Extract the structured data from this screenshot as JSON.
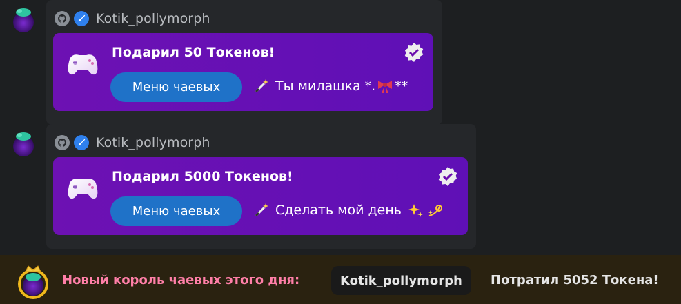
{
  "messages": [
    {
      "username": "Kotik_pollymorph",
      "title": "Подарил 50 Токенов!",
      "button_label": "Меню чаевых",
      "tip_text": "Ты милашка *.",
      "tip_suffix": "**",
      "tip_emoji": "bow"
    },
    {
      "username": "Kotik_pollymorph",
      "title": "Подарил 5000 Токенов!",
      "button_label": "Меню чаевых",
      "tip_text": "Сделать мой день",
      "tip_emoji": "sparkles-dizzy"
    }
  ],
  "footer": {
    "label": "Новый король чаевых этого дня:",
    "name": "Kotik_pollymorph",
    "spent": "Потратил 5052 Токена!"
  },
  "colors": {
    "background": "#1d1f21",
    "card": "#6a0dad",
    "button": "#1f72c8",
    "king_label": "#ff7fa8",
    "footer_bg": "#2a2210"
  },
  "icons": [
    "avatar-icon",
    "github-icon",
    "sword-badge-icon",
    "gamepad-icon",
    "verified-icon",
    "magic-wand-icon",
    "bow-emoji-icon",
    "sparkles-emoji-icon",
    "dizzy-emoji-icon",
    "crown-avatar-icon"
  ]
}
